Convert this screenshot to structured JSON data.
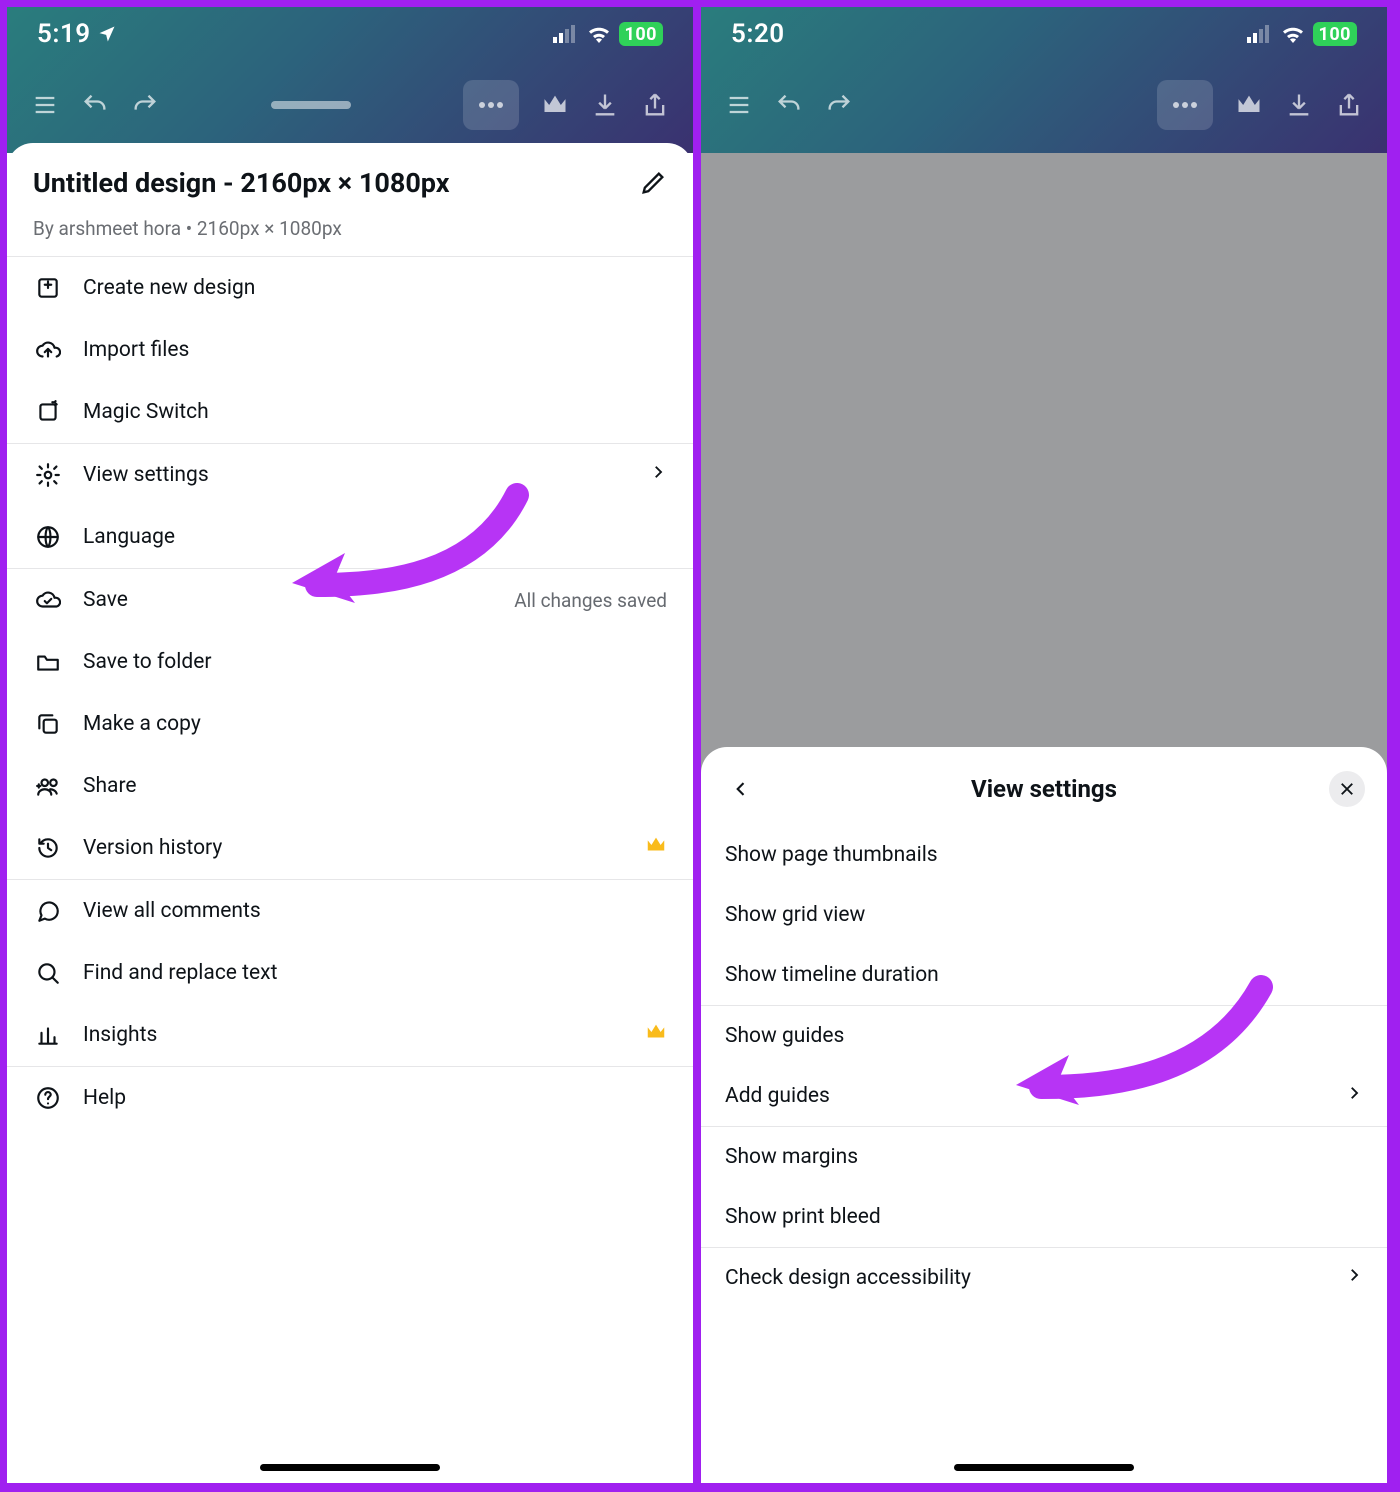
{
  "left": {
    "status": {
      "time": "5:19",
      "battery": "100"
    },
    "sheet": {
      "title": "Untitled design - 2160px × 1080px",
      "subtitle": "By arshmeet hora • 2160px × 1080px"
    },
    "groups": [
      {
        "items": [
          {
            "id": "create-new-design",
            "label": "Create new design",
            "icon": "create"
          },
          {
            "id": "import-files",
            "label": "Import files",
            "icon": "cloud-up"
          },
          {
            "id": "magic-switch",
            "label": "Magic Switch",
            "icon": "magic"
          }
        ]
      },
      {
        "items": [
          {
            "id": "view-settings",
            "label": "View settings",
            "icon": "gear",
            "chevron": true
          },
          {
            "id": "language",
            "label": "Language",
            "icon": "globe"
          }
        ]
      },
      {
        "items": [
          {
            "id": "save",
            "label": "Save",
            "icon": "cloud-check",
            "trailing": "All changes saved"
          },
          {
            "id": "save-to-folder",
            "label": "Save to folder",
            "icon": "folder"
          },
          {
            "id": "make-a-copy",
            "label": "Make a copy",
            "icon": "copy"
          },
          {
            "id": "share",
            "label": "Share",
            "icon": "share-people"
          },
          {
            "id": "version-history",
            "label": "Version history",
            "icon": "history",
            "crown": true
          }
        ]
      },
      {
        "items": [
          {
            "id": "view-all-comments",
            "label": "View all comments",
            "icon": "comment"
          },
          {
            "id": "find-replace",
            "label": "Find and replace text",
            "icon": "search"
          },
          {
            "id": "insights",
            "label": "Insights",
            "icon": "chart",
            "crown": true
          }
        ]
      },
      {
        "items": [
          {
            "id": "help",
            "label": "Help",
            "icon": "help"
          }
        ]
      }
    ]
  },
  "right": {
    "status": {
      "time": "5:20",
      "battery": "100"
    },
    "sheet_title": "View settings",
    "groups": [
      {
        "items": [
          {
            "id": "show-page-thumbnails",
            "label": "Show page thumbnails"
          },
          {
            "id": "show-grid-view",
            "label": "Show grid view"
          },
          {
            "id": "show-timeline-duration",
            "label": "Show timeline duration"
          }
        ]
      },
      {
        "items": [
          {
            "id": "show-guides",
            "label": "Show guides"
          },
          {
            "id": "add-guides",
            "label": "Add guides",
            "chevron": true
          }
        ]
      },
      {
        "items": [
          {
            "id": "show-margins",
            "label": "Show margins"
          },
          {
            "id": "show-print-bleed",
            "label": "Show print bleed"
          }
        ]
      },
      {
        "items": [
          {
            "id": "check-accessibility",
            "label": "Check design accessibility",
            "chevron": true
          }
        ]
      }
    ]
  }
}
